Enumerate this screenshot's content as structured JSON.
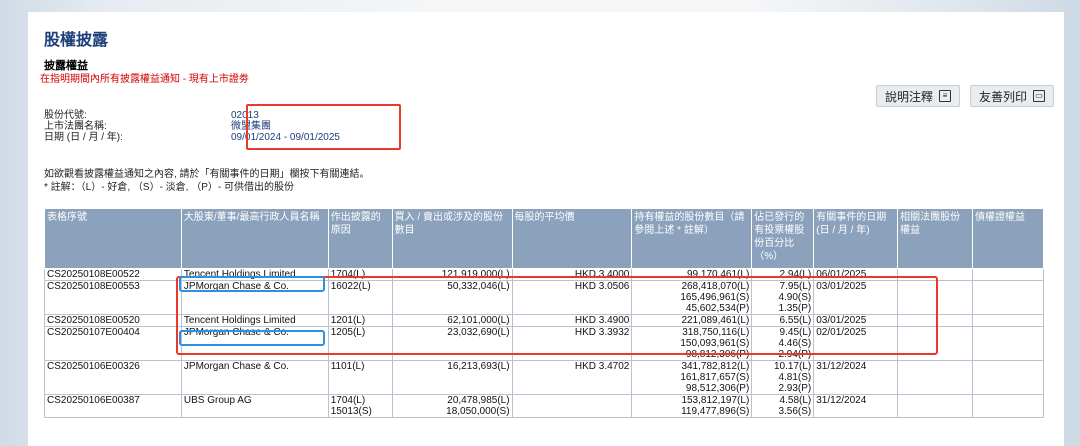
{
  "page": {
    "title": "股權披露",
    "subtitle": "披露權益",
    "notice": "在指明期間內所有披露權益通知 - 現有上市證劵"
  },
  "buttons": {
    "explain": "說明注釋",
    "print": "友善列印"
  },
  "info": {
    "stock_code_label": "股份代號:",
    "stock_code": "02013",
    "company_label": "上市法團名稱:",
    "company": "微盟集團",
    "date_label": "日期 (日 / 月 / 年):",
    "date_range": "09/01/2024 - 09/01/2025"
  },
  "notes": {
    "line1": "如欲觀看披露權益通知之內容, 請於「有關事件的日期」欄按下有關連結。",
    "line2": "* 註解：（L）- 好倉, （S）- 淡倉, （P）- 可供借出的股份"
  },
  "table": {
    "headers": [
      "表格序號",
      "大股東/董事/最高行政人員名稱",
      "作出披露的原因",
      "買入 / 賣出或涉及的股份數目",
      "每股的平均價",
      "持有權益的股份數目（請參閱上述 * 註解）",
      "佔已發行的有投票權股份百分比（%）",
      "有關事件的日期 (日 / 月 / 年)",
      "相關法團股份權益",
      "債權證權益"
    ],
    "rows": [
      {
        "id": "CS20250108E00522",
        "name": "Tencent Holdings Limited",
        "reason": "1704(L)",
        "shares": "121,919,000(L)",
        "price": "HKD 3.4000",
        "held": "99,170,461(L)",
        "pct": "2.94(L)",
        "date": "06/01/2025"
      },
      {
        "id": "CS20250108E00553",
        "name": "JPMorgan Chase & Co.",
        "reason": "16022(L)",
        "shares": "50,332,046(L)",
        "price": "HKD 3.0506",
        "held": "268,418,070(L)\n165,496,961(S)\n45,602,534(P)",
        "pct": "7.95(L)\n4.90(S)\n1.35(P)",
        "date": "03/01/2025"
      },
      {
        "id": "CS20250108E00520",
        "name": "Tencent Holdings Limited",
        "reason": "1201(L)",
        "shares": "62,101,000(L)",
        "price": "HKD 3.4900",
        "held": "221,089,461(L)",
        "pct": "6.55(L)",
        "date": "03/01/2025"
      },
      {
        "id": "CS20250107E00404",
        "name": "JPMorgan Chase & Co.",
        "reason": "1205(L)",
        "shares": "23,032,690(L)",
        "price": "HKD 3.3932",
        "held": "318,750,116(L)\n150,093,961(S)\n98,812,306(P)",
        "pct": "9.45(L)\n4.46(S)\n2.94(P)",
        "date": "02/01/2025"
      },
      {
        "id": "CS20250106E00326",
        "name": "JPMorgan Chase & Co.",
        "reason": "1101(L)",
        "shares": "16,213,693(L)",
        "price": "HKD 3.4702",
        "held": "341,782,812(L)\n161,817,657(S)\n98,512,306(P)",
        "pct": "10.17(L)\n4.81(S)\n2.93(P)",
        "date": "31/12/2024"
      },
      {
        "id": "CS20250106E00387",
        "name": "UBS Group AG",
        "reason": "1704(L)\n15013(S)",
        "shares": "20,478,985(L)\n18,050,000(S)",
        "price": "",
        "held": "153,812,197(L)\n119,477,896(S)",
        "pct": "4.58(L)\n3.56(S)",
        "date": "31/12/2024"
      }
    ]
  },
  "colors": {
    "accent_red": "#e8392c",
    "accent_blue": "#2f8fe0",
    "header_bg": "#8ca2bc",
    "title_color": "#1e3f7a"
  }
}
